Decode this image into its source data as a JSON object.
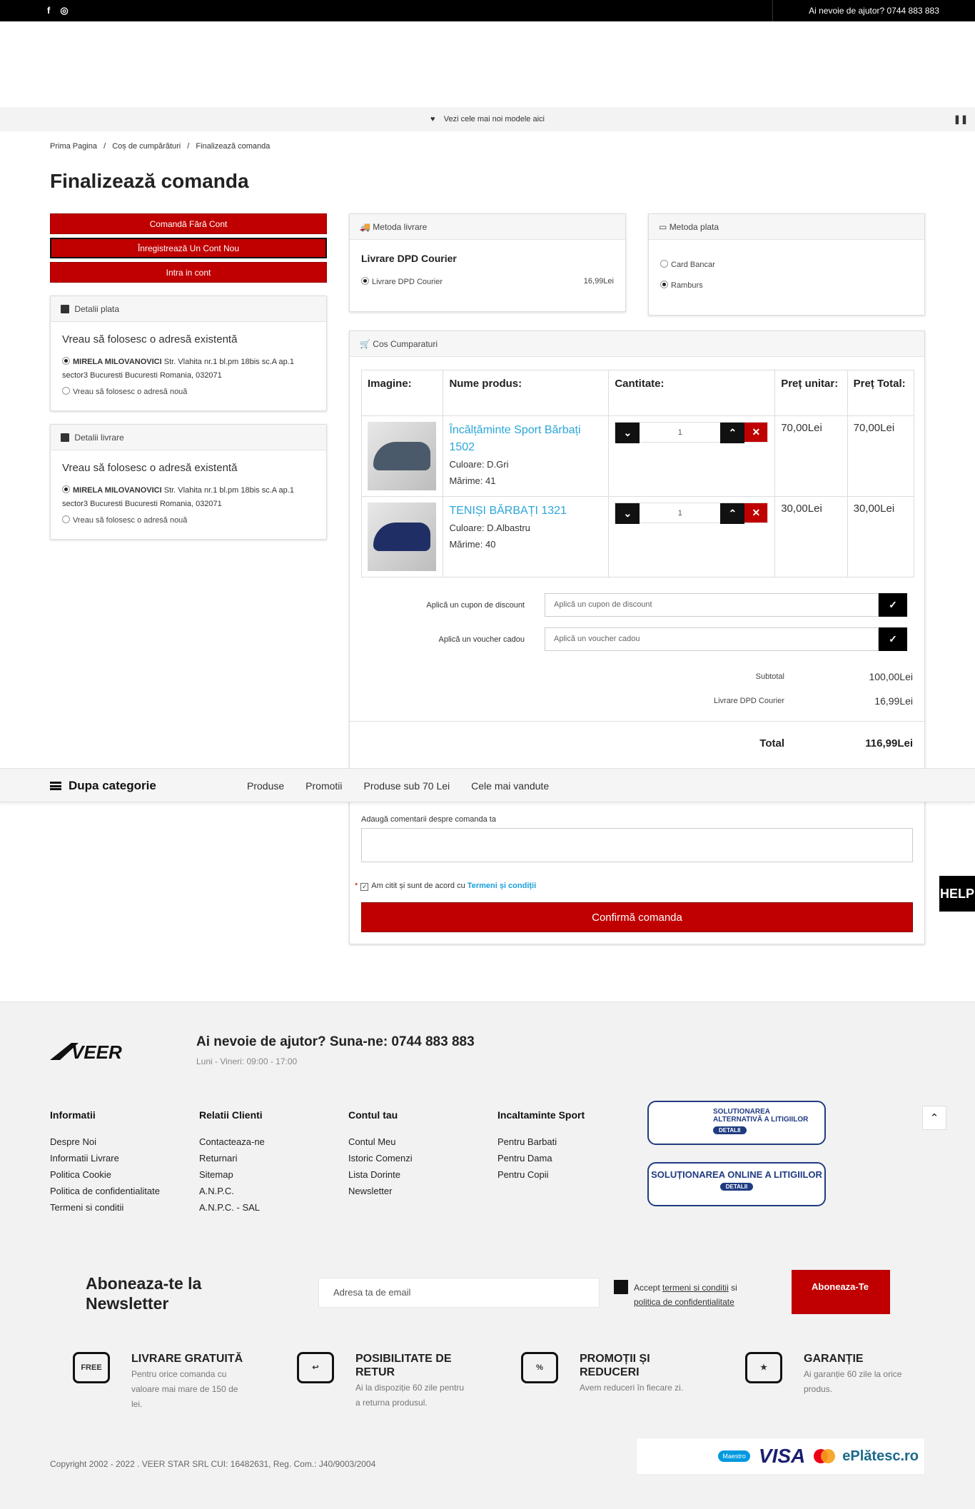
{
  "topbar": {
    "facebook_glyph": "f",
    "instagram_glyph": "◎",
    "help": "Ai nevoie de ajutor? 0744 883 883"
  },
  "announce": {
    "text": "Vezi cele mai noi modele aici",
    "pause": "❚❚"
  },
  "breadcrumb": [
    "Prima Pagina",
    "/",
    "Coș de cumpărături",
    "/",
    "Finalizează comanda"
  ],
  "page_title": "Finalizează comanda",
  "account_buttons": {
    "guest": "Comandă Fără Cont",
    "register": "Înregistrează Un Cont Nou",
    "login": "Intra in cont"
  },
  "billing": {
    "title": "Detalii plata",
    "lead": "Vreau să folosesc o adresă existentă",
    "name": "MIRELA MILOVANOVICI",
    "address1": "Str. Vlahita nr.1 bl.pm 18bis sc.A ap.1",
    "address2": "sector3 Bucuresti Bucuresti Romania, 032071",
    "new_address": "Vreau să folosesc o adresă nouă"
  },
  "shipping_address": {
    "title": "Detalii livrare",
    "lead": "Vreau să folosesc o adresă existentă",
    "name": "MIRELA MILOVANOVICI",
    "address1": "Str. Vlahita nr.1 bl.pm 18bis sc.A ap.1",
    "address2": "sector3 Bucuresti Bucuresti Romania, 032071",
    "new_address": "Vreau să folosesc o adresă nouă"
  },
  "shipping_method": {
    "title": "Metoda livrare",
    "heading": "Livrare DPD Courier",
    "option": "Livrare DPD Courier",
    "price": "16,99Lei"
  },
  "payment_method": {
    "title": "Metoda plata",
    "card": "Card Bancar",
    "cash": "Ramburs"
  },
  "cart": {
    "title": "Cos Cumparaturi",
    "headers": {
      "image": "Imagine:",
      "name": "Nume produs:",
      "qty": "Cantitate:",
      "unit": "Preț unitar:",
      "total": "Preț Total:"
    },
    "items": [
      {
        "name": "Încălțăminte Sport Bărbați 1502",
        "color": "Culoare: D.Gri",
        "size": "Mărime: 41",
        "qty": "1",
        "unit": "70,00Lei",
        "total": "70,00Lei",
        "shoe_color": "#4a5a6a"
      },
      {
        "name": "TENIȘI BĂRBAȚI 1321",
        "color": "Culoare: D.Albastru",
        "size": "Mărime: 40",
        "qty": "1",
        "unit": "30,00Lei",
        "total": "30,00Lei",
        "shoe_color": "#1f2f66"
      }
    ],
    "coupon_label": "Aplică un cupon de discount",
    "coupon_placeholder": "Aplică un cupon de discount",
    "voucher_label": "Aplică un voucher cadou",
    "voucher_placeholder": "Aplică un voucher cadou",
    "subtotal_label": "Subtotal",
    "subtotal": "100,00Lei",
    "shipping_label": "Livrare DPD Courier",
    "shipping": "16,99Lei",
    "total_label": "Total",
    "total": "116,99Lei"
  },
  "catbar": {
    "title": "Dupa categorie",
    "links": [
      "Produse",
      "Promotii",
      "Produse sub 70 Lei",
      "Cele mai vandute"
    ]
  },
  "comments": {
    "label": "Adaugă comentarii despre comanda ta"
  },
  "terms": {
    "star": "*",
    "text": "Am citit și sunt de acord cu",
    "link": "Termeni și condiții"
  },
  "confirm": "Confirmă comanda",
  "help_tab": "HELP",
  "footer": {
    "logo": "VEER",
    "help": "Ai nevoie de ajutor? Suna-ne: 0744 883 883",
    "hours": "Luni - Vineri: 09:00 - 17:00",
    "cols": [
      {
        "title": "Informatii",
        "links": [
          "Despre Noi",
          "Informatii Livrare",
          "Politica Cookie",
          "Politica de confidentialitate",
          "Termeni si conditii"
        ]
      },
      {
        "title": "Relatii Clienti",
        "links": [
          "Contacteaza-ne",
          "Returnari",
          "Sitemap",
          "A.N.P.C.",
          "A.N.P.C. - SAL"
        ]
      },
      {
        "title": "Contul tau",
        "links": [
          "Contul Meu",
          "Istoric Comenzi",
          "Lista Dorinte",
          "Newsletter"
        ]
      },
      {
        "title": "Incaltaminte Sport",
        "links": [
          "Pentru Barbati",
          "Pentru Dama",
          "Pentru Copii"
        ]
      }
    ],
    "anpc_sal": "SOLUTIONAREA ALTERNATIVĂ A LITIGIILOR",
    "anpc_sol": "SOLUȚIONAREA ONLINE A LITIGIILOR",
    "details": "DETALII",
    "newsletter_title": "Aboneaza-te la Newsletter",
    "newsletter_placeholder": "Adresa ta de email",
    "accept_prefix": "Accept",
    "accept_terms": "termeni si conditii",
    "accept_mid": "si",
    "accept_policy": "politica de confidentialitate",
    "subscribe": "Aboneaza-Te",
    "features": [
      {
        "icon": "FREE",
        "title": "LIVRARE GRATUITĂ",
        "text": "Pentru orice comanda cu valoare mai mare de 150 de lei."
      },
      {
        "icon": "↩",
        "title": "POSIBILITATE DE RETUR",
        "text": "Ai la dispoziție 60 zile pentru a returna produsul."
      },
      {
        "icon": "%",
        "title": "PROMOȚII ȘI REDUCERI",
        "text": "Avem reduceri în fiecare zi."
      },
      {
        "icon": "★",
        "title": "GARANȚIE",
        "text": "Ai garanție 60 zile la orice produs."
      }
    ],
    "copyright": "Copyright 2002 - 2022 . VEER STAR SRL CUI: 16482631, Reg. Com.: J40/9003/2004",
    "payments": {
      "maestro": "Maestro",
      "visa": "VISA",
      "platesc": "ePlătesc.ro"
    }
  }
}
